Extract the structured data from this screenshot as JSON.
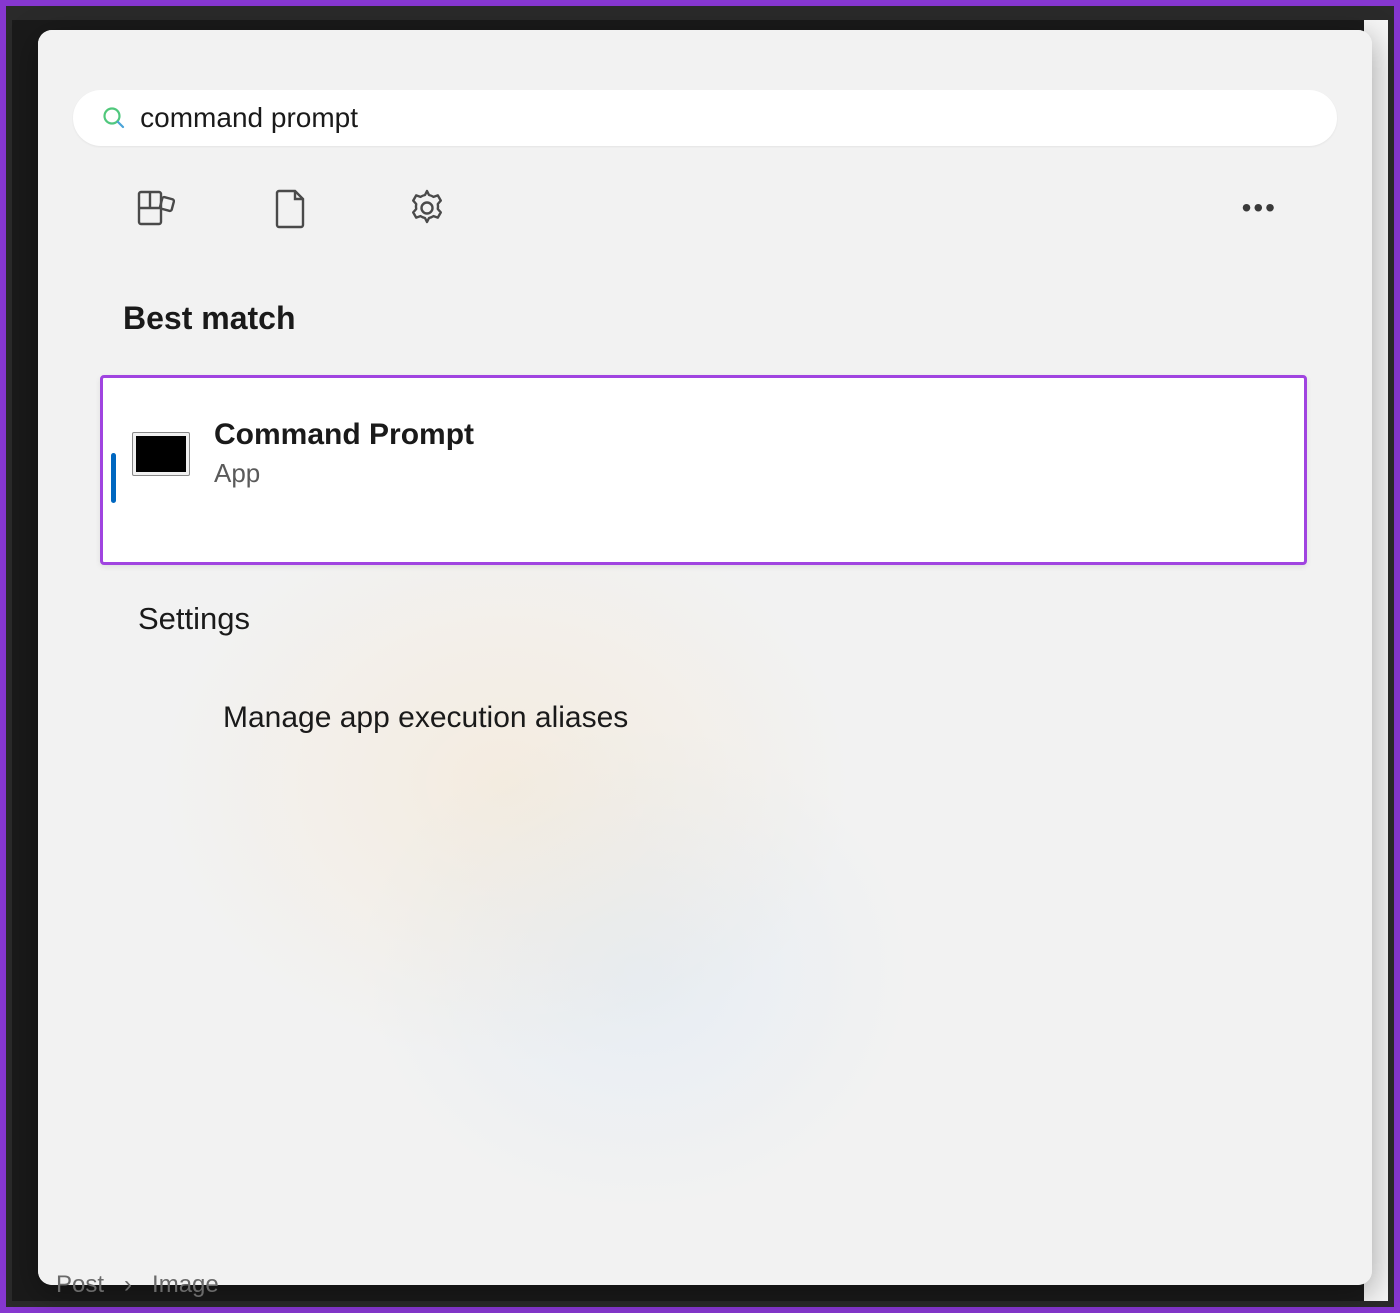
{
  "search": {
    "value": "command prompt"
  },
  "filters": {
    "apps": "apps-filter",
    "documents": "documents-filter",
    "settings": "settings-filter",
    "more": "•••"
  },
  "sections": {
    "best_match_label": "Best match",
    "settings_label": "Settings"
  },
  "best_match": {
    "title": "Command Prompt",
    "subtitle": "App"
  },
  "settings_results": {
    "item1": "Manage app execution aliases"
  },
  "footer": {
    "word1": "Post",
    "chev": "›",
    "word2": "Image"
  }
}
